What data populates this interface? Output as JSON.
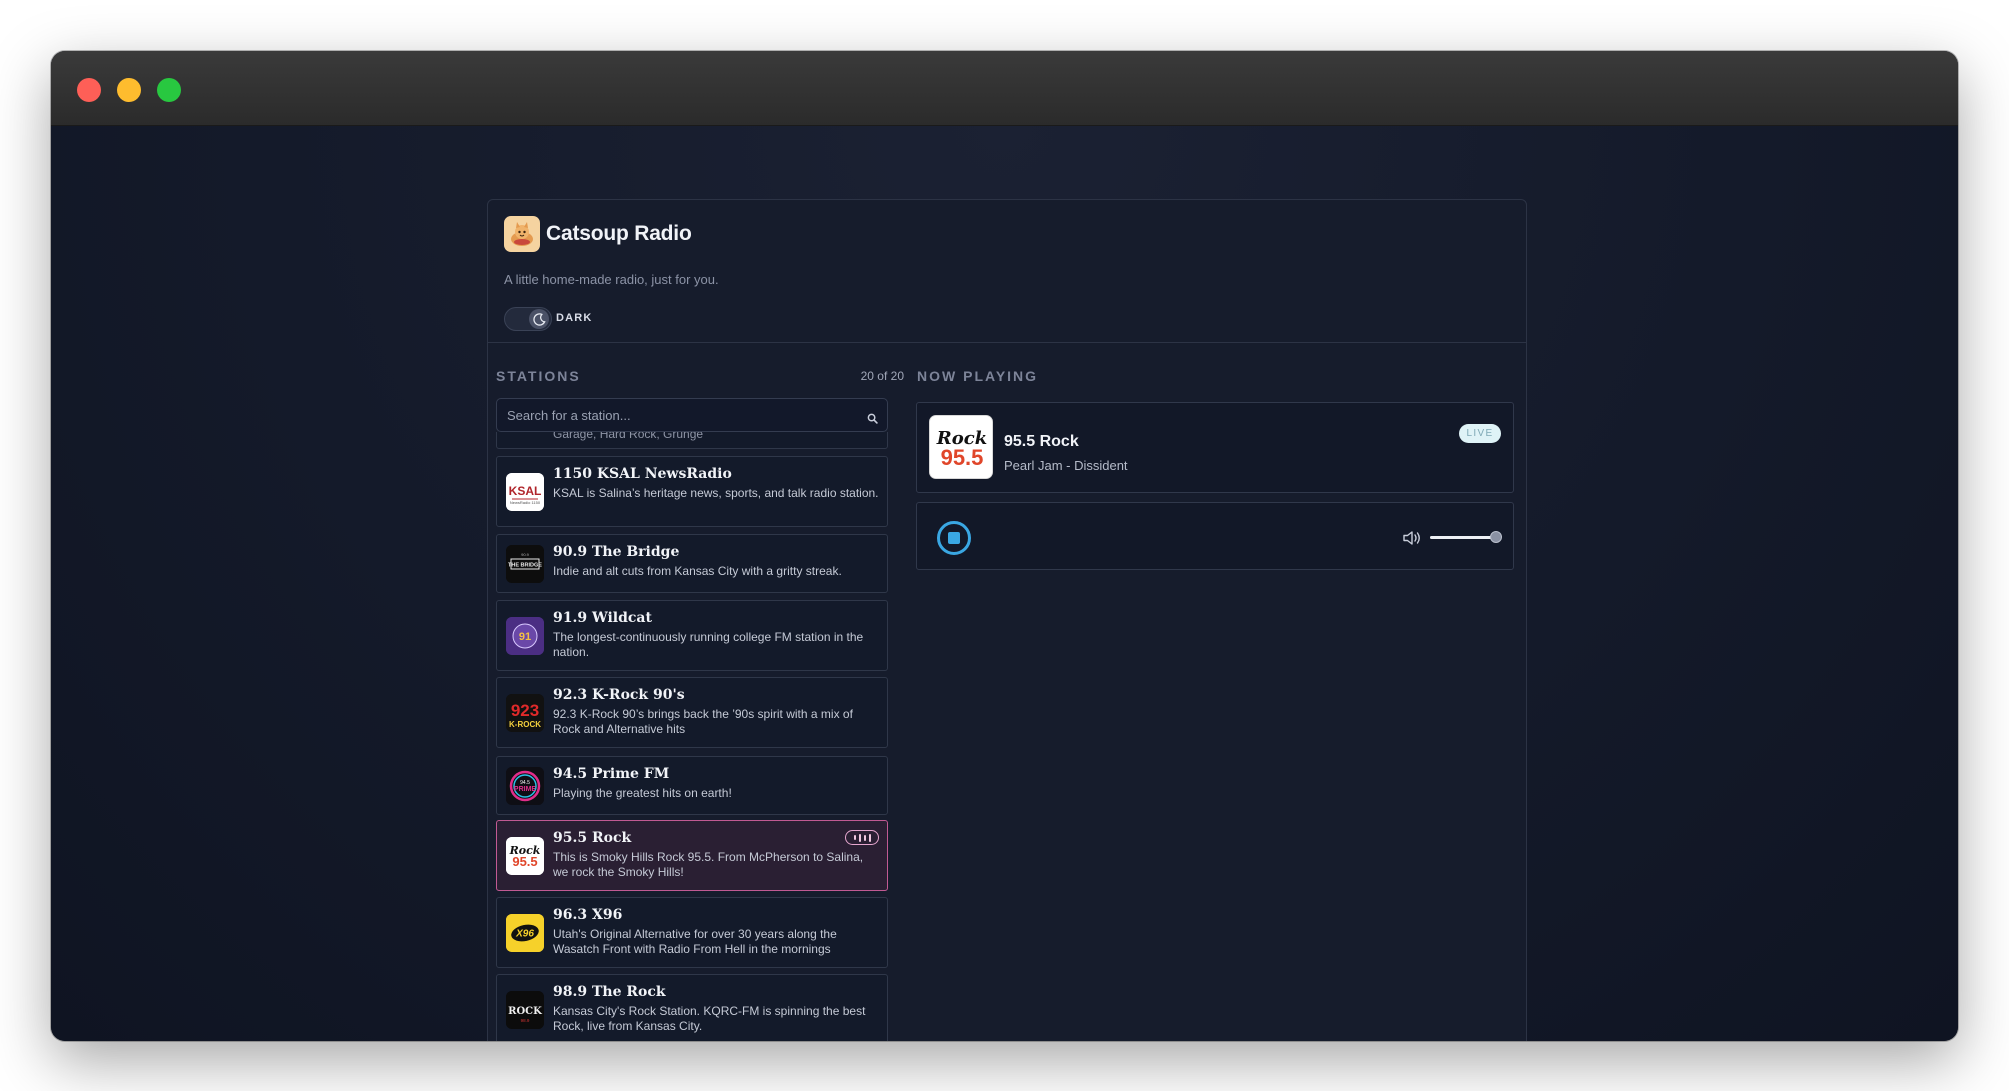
{
  "app": {
    "title": "Catsoup Radio",
    "tagline": "A little home-made radio, just for you.",
    "theme_label": "DARK"
  },
  "stations": {
    "heading": "STATIONS",
    "count": "20 of 20",
    "search_placeholder": "Search for a station...",
    "partial_top_text": "Garage, Hard Rock, Grunge",
    "items": [
      {
        "name": "1150 KSAL NewsRadio",
        "description": "KSAL is Salina’s heritage news, sports, and talk radio station.",
        "logo": "ksal-logo"
      },
      {
        "name": "90.9 The Bridge",
        "description": "Indie and alt cuts from Kansas City with a gritty streak.",
        "logo": "the-bridge-logo"
      },
      {
        "name": "91.9 Wildcat",
        "description": "The longest-continuously running college FM station in the nation.",
        "logo": "wildcat-logo"
      },
      {
        "name": "92.3 K-Rock 90's",
        "description": "92.3 K-Rock 90’s brings back the ’90s spirit with a mix of Rock and Alternative hits",
        "logo": "krock-logo"
      },
      {
        "name": "94.5 Prime FM",
        "description": "Playing the greatest hits on earth!",
        "logo": "prime-fm-logo"
      },
      {
        "name": "95.5 Rock",
        "description": "This is Smoky Hills Rock 95.5. From McPherson to Salina, we rock the Smoky Hills!",
        "logo": "rock-955-logo",
        "active": true
      },
      {
        "name": "96.3 X96",
        "description": "Utah's Original Alternative for over 30 years along the Wasatch Front with Radio From Hell in the mornings",
        "logo": "x96-logo"
      },
      {
        "name": "98.9 The Rock",
        "description": "Kansas City's Rock Station. KQRC-FM is spinning the best Rock, live from Kansas City.",
        "logo": "the-rock-logo"
      }
    ]
  },
  "now_playing": {
    "heading": "NOW PLAYING",
    "station": "95.5 Rock",
    "track": "Pearl Jam - Dissident",
    "badge": "LIVE",
    "volume": 0.92
  },
  "colors": {
    "accent": "#3aa7e3",
    "active_border": "#c15a93",
    "background": "#141a2b"
  }
}
